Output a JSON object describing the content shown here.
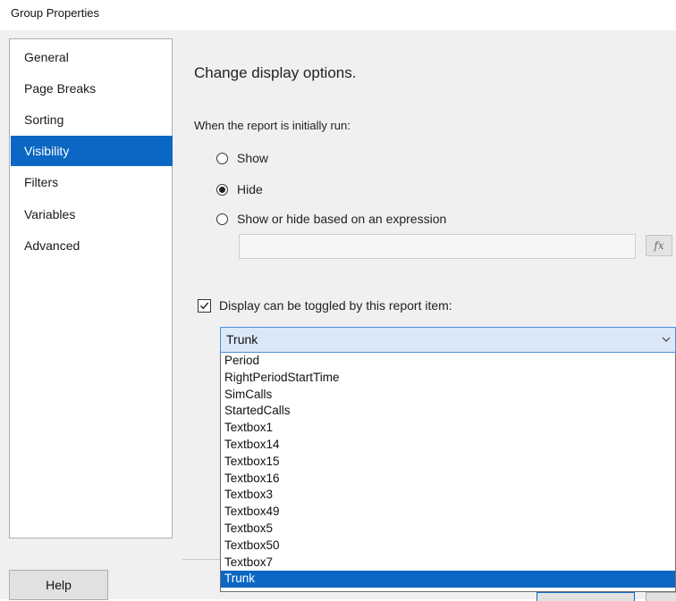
{
  "window": {
    "title": "Group Properties"
  },
  "sidebar": {
    "items": [
      {
        "label": "General"
      },
      {
        "label": "Page Breaks"
      },
      {
        "label": "Sorting"
      },
      {
        "label": "Visibility",
        "selected": true
      },
      {
        "label": "Filters"
      },
      {
        "label": "Variables"
      },
      {
        "label": "Advanced"
      }
    ]
  },
  "main": {
    "heading": "Change display options.",
    "initial_label": "When the report is initially run:",
    "options": [
      {
        "label": "Show",
        "checked": false
      },
      {
        "label": "Hide",
        "checked": true
      },
      {
        "label": "Show or hide based on an expression",
        "checked": false
      }
    ],
    "expression_value": "",
    "fx_label": "fx",
    "toggle": {
      "label": "Display can be toggled by this report item:",
      "checked": true
    },
    "combo_value": "Trunk",
    "dropdown_items": [
      "Period",
      "RightPeriodStartTime",
      "SimCalls",
      "StartedCalls",
      "Textbox1",
      "Textbox14",
      "Textbox15",
      "Textbox16",
      "Textbox3",
      "Textbox49",
      "Textbox5",
      "Textbox50",
      "Textbox7",
      "Trunk"
    ],
    "dropdown_selected": "Trunk"
  },
  "footer": {
    "help_label": "Help"
  },
  "colors": {
    "accent": "#0b67c3",
    "panel": "#f0f0f0"
  }
}
